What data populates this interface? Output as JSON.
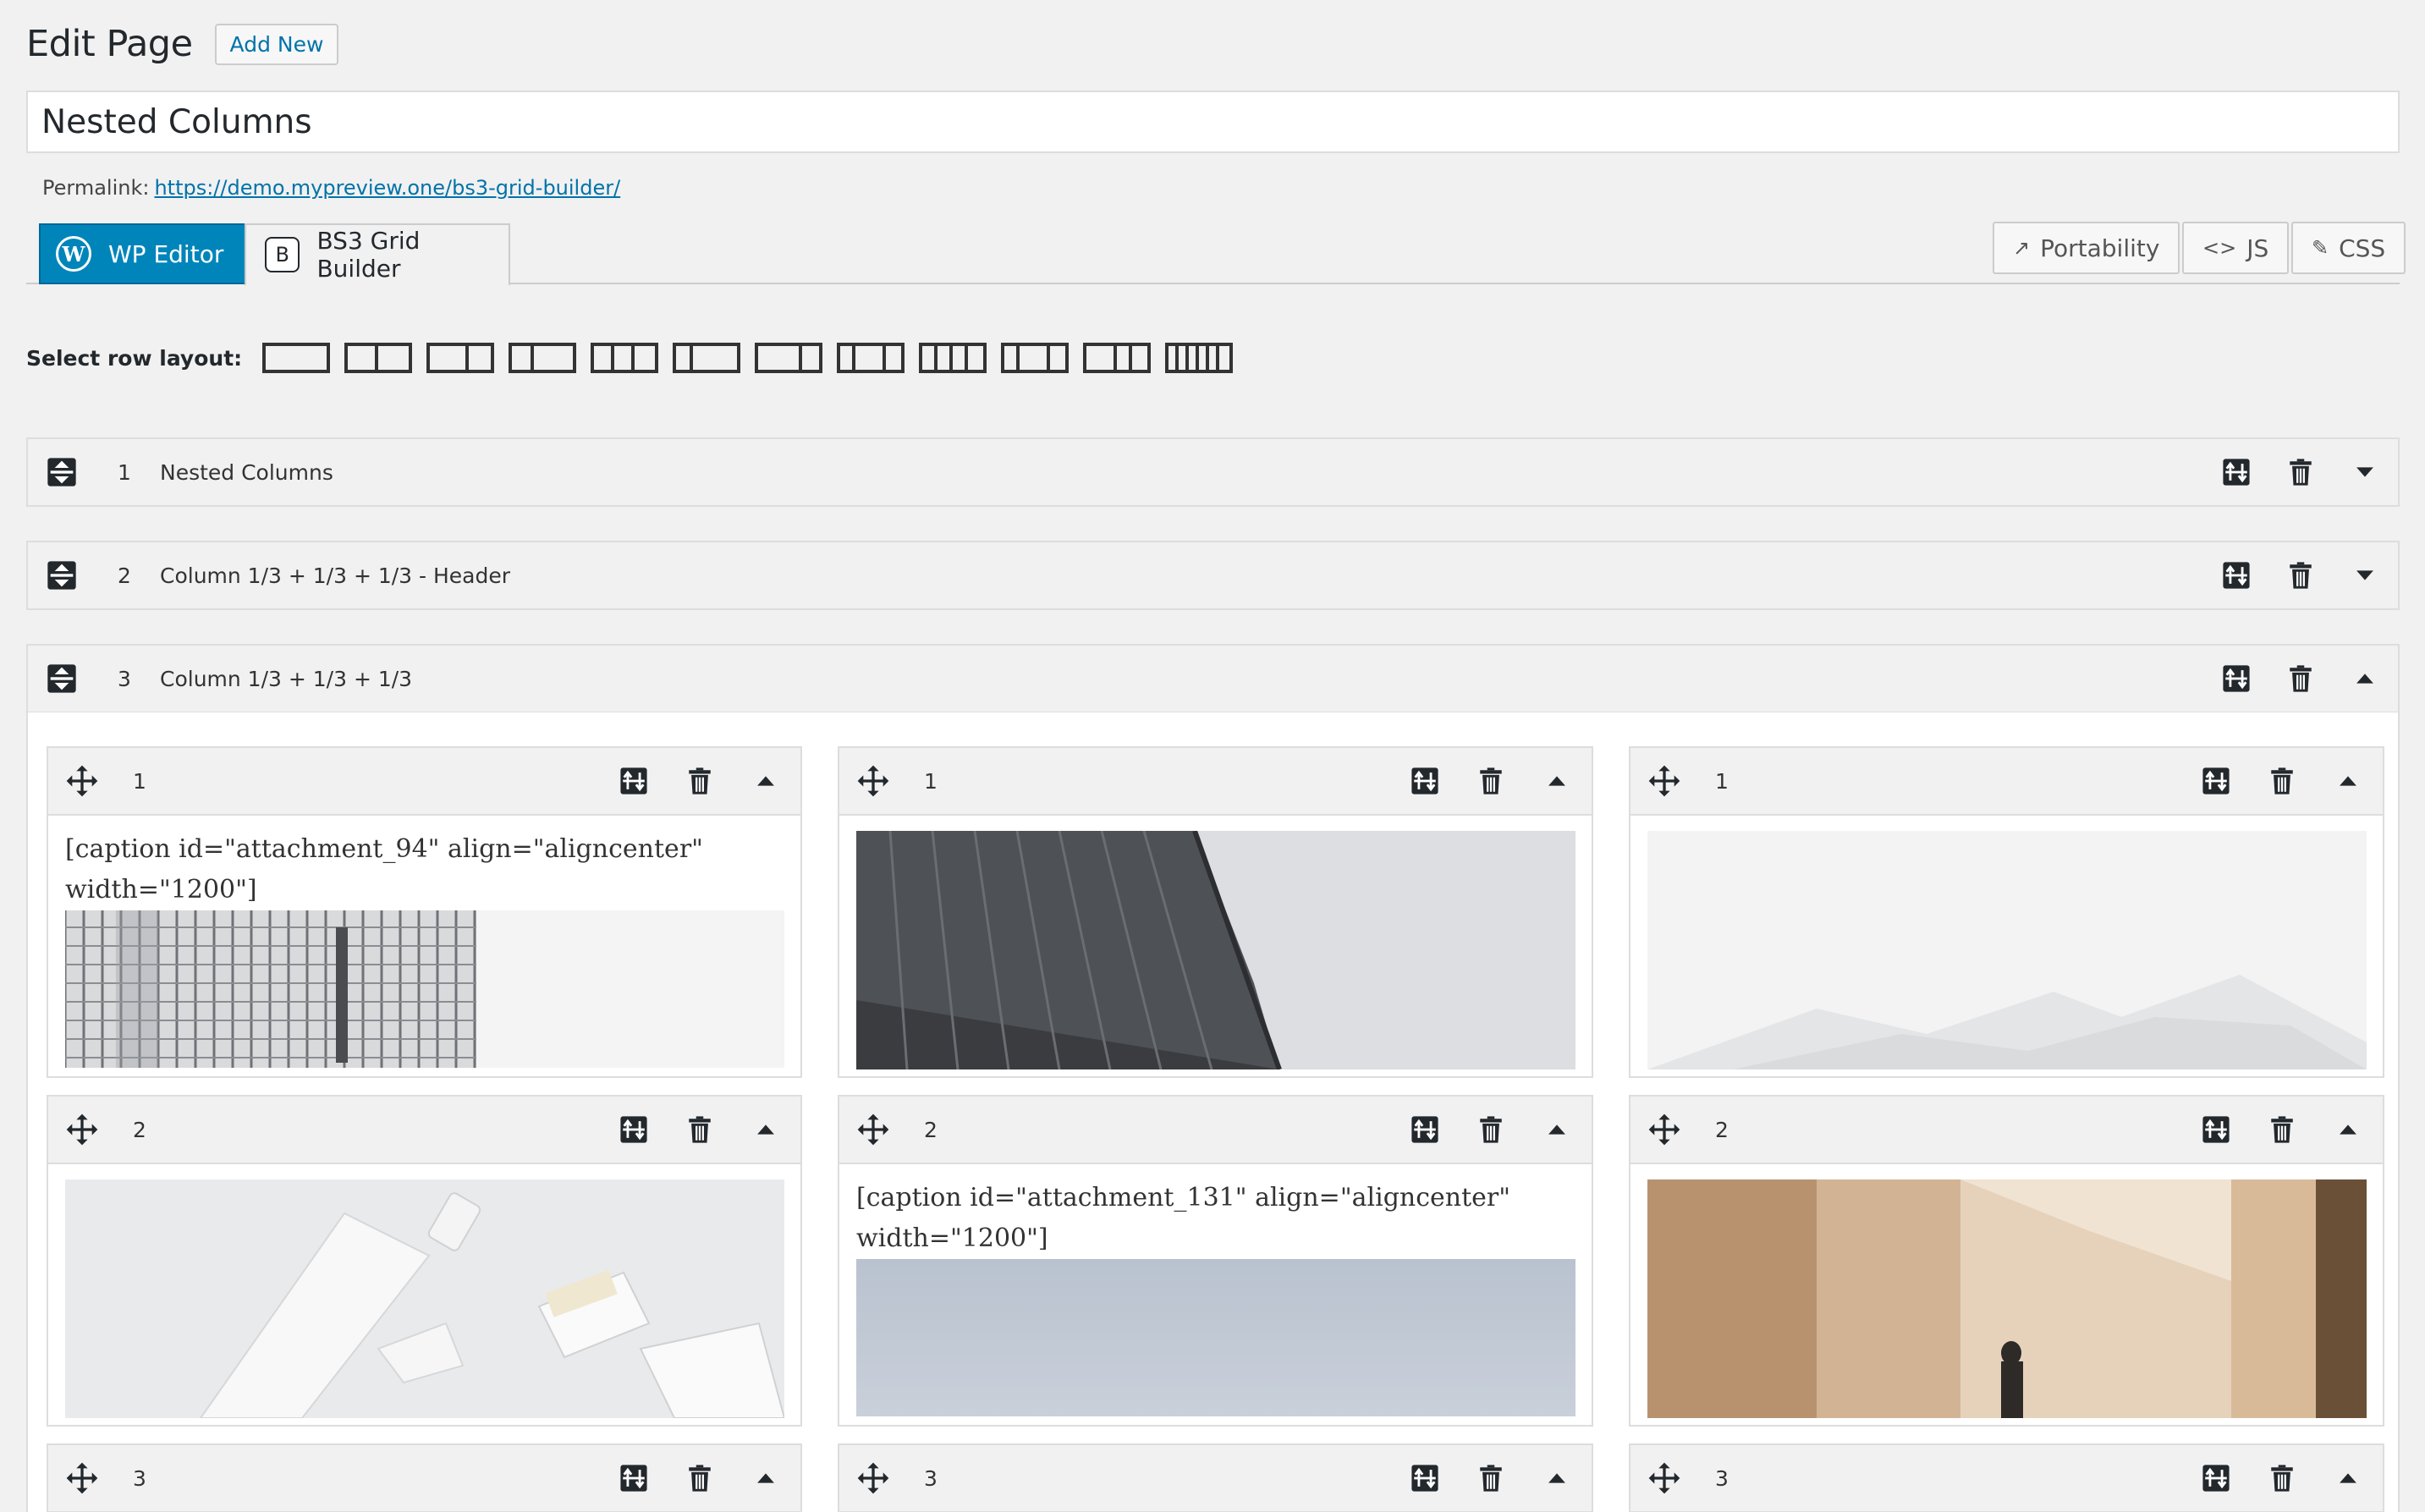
{
  "header": {
    "title": "Edit Page",
    "add_new": "Add New"
  },
  "post_title": "Nested Columns",
  "permalink": {
    "label": "Permalink:",
    "url": "https://demo.mypreview.one/bs3-grid-builder/"
  },
  "tabs": {
    "wp_editor": "WP Editor",
    "bs3": "BS3 Grid Builder",
    "bs3_logo": "B"
  },
  "tools": {
    "portability": "Portability",
    "js": "JS",
    "css": "CSS"
  },
  "layout_selector": {
    "label": "Select row layout:"
  },
  "rows": [
    {
      "num": "1",
      "title": "Nested Columns"
    },
    {
      "num": "2",
      "title": "Column 1/3 + 1/3 + 1/3 - Header"
    },
    {
      "num": "3",
      "title": "Column 1/3 + 1/3 + 1/3"
    }
  ],
  "columns": {
    "c1": {
      "num": "1",
      "caption": "[caption id=\"attachment_94\" align=\"aligncenter\" width=\"1200\"]"
    },
    "c2": {
      "num": "1"
    },
    "c3": {
      "num": "1"
    },
    "c4": {
      "num": "2"
    },
    "c5": {
      "num": "2",
      "caption": "[caption id=\"attachment_131\" align=\"aligncenter\" width=\"1200\"]"
    },
    "c6": {
      "num": "2"
    },
    "c7": {
      "num": "3"
    },
    "c8": {
      "num": "3"
    },
    "c9": {
      "num": "3"
    }
  },
  "icons": {
    "move": "move-icon",
    "settings": "settings-icon",
    "trash": "trash-icon",
    "collapse": "chevron-up-icon",
    "expand": "chevron-down-icon"
  },
  "colors": {
    "accent": "#0085ba",
    "link": "#0073aa",
    "background": "#f1f1f1"
  }
}
